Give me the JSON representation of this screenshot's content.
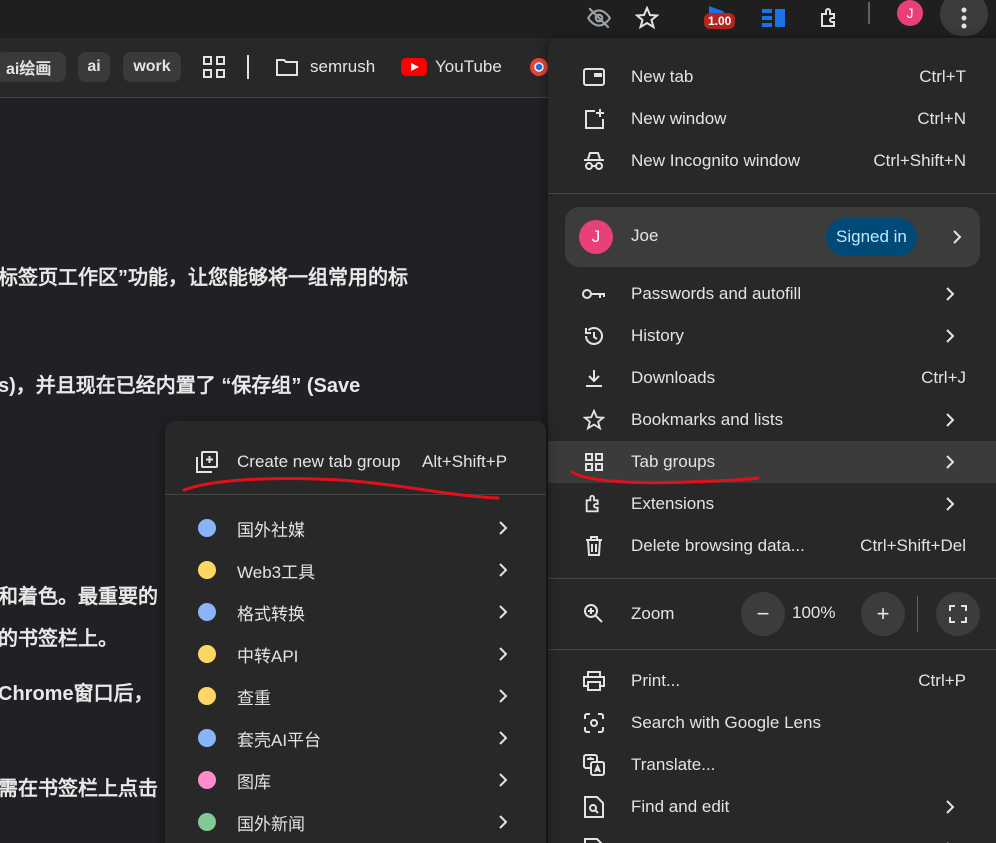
{
  "toolbar": {
    "extension_badge": "1.00",
    "avatar_initial": "J"
  },
  "bookmarks": {
    "chips": [
      "ai绘画",
      "ai",
      "work"
    ],
    "items": [
      "semrush",
      "YouTube"
    ]
  },
  "page": {
    "lines": [
      "标签页工作区”功能，让您能够将一组常用的标",
      "s)，并且现在已经内置了 “保存组” (Save",
      "和着色。最重要的",
      "的书签栏上。",
      "Chrome窗口后，",
      "需在书签栏上点击"
    ]
  },
  "main_menu": {
    "new_tab": {
      "label": "New tab",
      "shortcut": "Ctrl+T"
    },
    "new_window": {
      "label": "New window",
      "shortcut": "Ctrl+N"
    },
    "new_incognito": {
      "label": "New Incognito window",
      "shortcut": "Ctrl+Shift+N"
    },
    "profile": {
      "initial": "J",
      "name": "Joe",
      "status": "Signed in"
    },
    "passwords": {
      "label": "Passwords and autofill"
    },
    "history": {
      "label": "History"
    },
    "downloads": {
      "label": "Downloads",
      "shortcut": "Ctrl+J"
    },
    "bookmarks": {
      "label": "Bookmarks and lists"
    },
    "tab_groups": {
      "label": "Tab groups"
    },
    "extensions": {
      "label": "Extensions"
    },
    "delete_data": {
      "label": "Delete browsing data...",
      "shortcut": "Ctrl+Shift+Del"
    },
    "zoom": {
      "label": "Zoom",
      "value": "100%",
      "minus": "−",
      "plus": "+"
    },
    "print": {
      "label": "Print...",
      "shortcut": "Ctrl+P"
    },
    "lens": {
      "label": "Search with Google Lens"
    },
    "translate": {
      "label": "Translate..."
    },
    "find_edit": {
      "label": "Find and edit"
    }
  },
  "sub_menu": {
    "create": {
      "label": "Create new tab group",
      "shortcut": "Alt+Shift+P"
    },
    "groups": [
      {
        "label": "国外社媒",
        "color": "#8ab4f8"
      },
      {
        "label": "Web3工具",
        "color": "#fdd663"
      },
      {
        "label": "格式转换",
        "color": "#8ab4f8"
      },
      {
        "label": "中转API",
        "color": "#fdd663"
      },
      {
        "label": "查重",
        "color": "#fdd663"
      },
      {
        "label": "套壳AI平台",
        "color": "#8ab4f8"
      },
      {
        "label": "图库",
        "color": "#ff8bcb"
      },
      {
        "label": "国外新闻",
        "color": "#81c995"
      }
    ]
  },
  "colors": {
    "annotation_red": "#e0101c",
    "avatar_pink": "#e8407a",
    "signed_in_bg": "#004a77"
  }
}
